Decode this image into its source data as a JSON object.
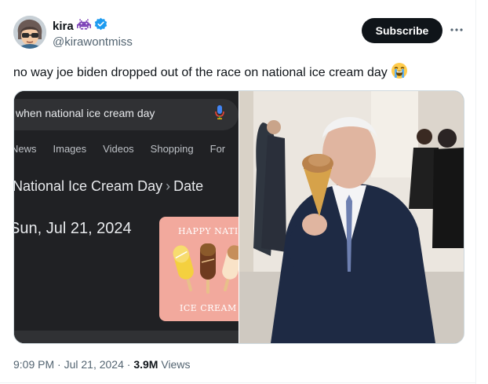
{
  "author": {
    "display_name": "kira",
    "handle": "@kirawontmiss",
    "verified": true,
    "emoji_icon": "space-invader-icon"
  },
  "header": {
    "subscribe_label": "Subscribe",
    "more_icon": "more-horizontal-icon"
  },
  "tweet": {
    "text": "no way joe biden dropped out of the race on national ice cream day",
    "emoji": "loudly-crying-face-icon"
  },
  "media": {
    "search": {
      "query": "when national ice cream day",
      "tabs": [
        "News",
        "Images",
        "Videos",
        "Shopping",
        "For"
      ],
      "title": "National Ice Cream Day",
      "title_separator": "›",
      "breadcrumb": "Date",
      "date": "Sun, Jul 21, 2024",
      "card_top": "HAPPY NATIONAL",
      "card_bottom": "ICE CREAM DAY"
    }
  },
  "meta": {
    "time": "9:09 PM",
    "date": "Jul 21, 2024",
    "views_count": "3.9M",
    "views_label": "Views"
  },
  "colors": {
    "text_primary": "#0f1419",
    "text_secondary": "#536471",
    "verified_blue": "#1d9bf0",
    "dark_bg": "#202124"
  }
}
